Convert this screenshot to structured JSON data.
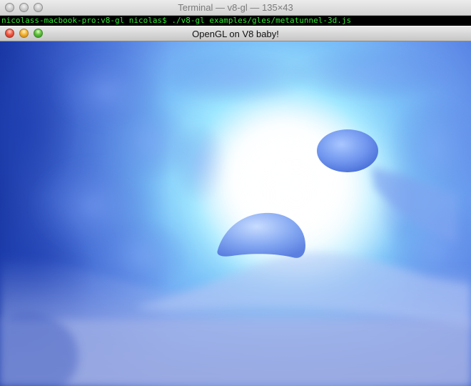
{
  "terminal": {
    "title": "Terminal — v8-gl — 135×43",
    "command_line": "nicolass-macbook-pro:v8-gl nicolas$ ./v8-gl examples/gles/metatunnel-3d.js"
  },
  "gl_window": {
    "title": "OpenGL on V8 baby!"
  },
  "colors": {
    "terminal_text": "#2fe52f",
    "tunnel_core": "#ffffff",
    "tunnel_mid": "#7ddfff",
    "tunnel_outer": "#5d86e6",
    "tunnel_shadow": "#1d3fb0"
  },
  "icons": {
    "close": "close-icon",
    "minimize": "minimize-icon",
    "zoom": "zoom-icon"
  }
}
